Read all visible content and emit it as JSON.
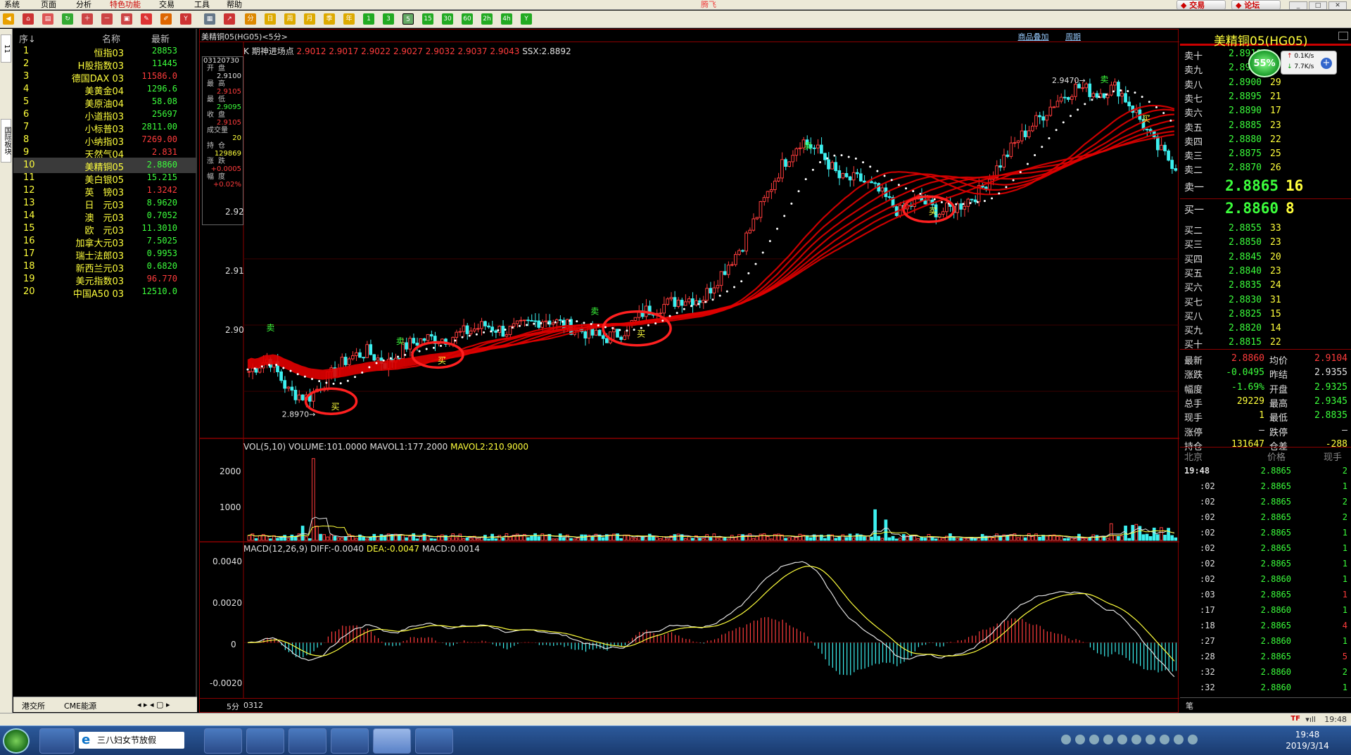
{
  "menu": {
    "items": [
      "系统",
      "页面",
      "分析",
      "特色功能",
      "交易",
      "工具",
      "帮助"
    ],
    "brand": "腾飞",
    "trade": "交易",
    "forum": "论坛"
  },
  "toolbar_periods": [
    "1",
    "3",
    "5",
    "15",
    "30",
    "60",
    "2h",
    "4h",
    "Y"
  ],
  "left_tabs": [
    "11",
    "国际板块"
  ],
  "watch": {
    "headers": {
      "seq": "序↓",
      "name": "名称",
      "last": "最新"
    },
    "rows": [
      {
        "n": "1",
        "name": "恒指03",
        "price": "28853",
        "color": "#3cff3c"
      },
      {
        "n": "2",
        "name": "H股指数03",
        "price": "11445",
        "color": "#3cff3c"
      },
      {
        "n": "3",
        "name": "德国DAX 03",
        "price": "11586.0",
        "color": "#ff3c3c"
      },
      {
        "n": "4",
        "name": "美黄金04",
        "price": "1296.6",
        "color": "#3cff3c"
      },
      {
        "n": "5",
        "name": "美原油04",
        "price": "58.08",
        "color": "#3cff3c"
      },
      {
        "n": "6",
        "name": "小道指03",
        "price": "25697",
        "color": "#3cff3c"
      },
      {
        "n": "7",
        "name": "小标普03",
        "price": "2811.00",
        "color": "#3cff3c"
      },
      {
        "n": "8",
        "name": "小纳指03",
        "price": "7269.00",
        "color": "#ff3c3c"
      },
      {
        "n": "9",
        "name": "天然气04",
        "price": "2.831",
        "color": "#ff3c3c"
      },
      {
        "n": "10",
        "name": "美精铜05",
        "price": "2.8860",
        "color": "#3cff3c"
      },
      {
        "n": "11",
        "name": "美白银05",
        "price": "15.215",
        "color": "#3cff3c"
      },
      {
        "n": "12",
        "name": "英　镑03",
        "price": "1.3242",
        "color": "#ff3c3c"
      },
      {
        "n": "13",
        "name": "日　元03",
        "price": "8.9620",
        "color": "#3cff3c"
      },
      {
        "n": "14",
        "name": "澳　元03",
        "price": "0.7052",
        "color": "#3cff3c"
      },
      {
        "n": "15",
        "name": "欧　元03",
        "price": "11.3010",
        "color": "#3cff3c"
      },
      {
        "n": "16",
        "name": "加拿大元03",
        "price": "7.5025",
        "color": "#3cff3c"
      },
      {
        "n": "17",
        "name": "瑞士法郎03",
        "price": "0.9953",
        "color": "#3cff3c"
      },
      {
        "n": "18",
        "name": "新西兰元03",
        "price": "0.6820",
        "color": "#3cff3c"
      },
      {
        "n": "19",
        "name": "美元指数03",
        "price": "96.770",
        "color": "#ff3c3c"
      },
      {
        "n": "20",
        "name": "中国A50 03",
        "price": "12510.0",
        "color": "#3cff3c"
      }
    ],
    "footer": {
      "tab1": "港交所",
      "tab2": "CME能源"
    }
  },
  "chart": {
    "title": "美精铜05(HG05)<5分>",
    "link1": "商品叠加",
    "link2": "周期",
    "info": {
      "date": "03120730",
      "open_l": "开盘",
      "open_v": "2.9100",
      "high_l": "最高",
      "high_v": "2.9105",
      "low_l": "最低",
      "low_v": "2.9095",
      "close_l": "收盘",
      "close_v": "2.9105",
      "vol_l": "成交量",
      "vol_v": "20",
      "oi_l": "持仓",
      "oi_v": "129869",
      "chg_l": "涨跌",
      "chg_v": "+0.0005",
      "pct_l": "幅度",
      "pct_v": "+0.02%"
    },
    "legend_k": {
      "k": "K",
      "name": "期神进场点",
      "values": "2.9012 2.9017 2.9022 2.9027 2.9032 2.9037 2.9043",
      "ssx": "SSX:2.8892"
    },
    "legend_vol": {
      "label": "VOL(5,10)",
      "volume": "VOLUME:101.0000",
      "m1": "MAVOL1:177.2000",
      "m2": "MAVOL2:210.9000"
    },
    "legend_macd": {
      "label": "MACD(12,26,9)",
      "diff": "DIFF:-0.0040",
      "dea": "DEA:-0.0047",
      "macd": "MACD:0.0014"
    },
    "y_labels_k": [
      "2.92",
      "2.91",
      "2.90"
    ],
    "y_labels_vol": [
      "2000",
      "1000"
    ],
    "y_labels_macd": [
      "0.0040",
      "0.0020",
      "0",
      "-0.0020"
    ],
    "hi_label": "2.9470",
    "lo_label": "2.8970",
    "sell_mark": "卖",
    "buy_mark": "买",
    "x_footer": {
      "period": "5分",
      "date": "0312"
    }
  },
  "chart_data": {
    "type": "candlestick",
    "title": "美精铜05(HG05)<5分>",
    "price_range": [
      2.893,
      2.9525
    ],
    "high_marked": 2.947,
    "low_marked": 2.897,
    "approx_close_path": [
      2.903,
      2.905,
      2.9,
      2.899,
      2.902,
      2.905,
      2.906,
      2.904,
      2.907,
      2.908,
      2.908,
      2.909,
      2.91,
      2.909,
      2.91,
      2.911,
      2.91,
      2.909,
      2.908,
      2.909,
      2.912,
      2.913,
      2.914,
      2.914,
      2.918,
      2.922,
      2.928,
      2.934,
      2.938,
      2.936,
      2.932,
      2.932,
      2.93,
      2.927,
      2.929,
      2.927,
      2.928,
      2.93,
      2.934,
      2.938,
      2.941,
      2.944,
      2.946,
      2.945,
      2.946,
      2.942,
      2.937,
      2.934
    ],
    "volume_range": [
      0,
      2600
    ],
    "volume_peak": 2400,
    "macd_range": [
      -0.0028,
      0.0045
    ],
    "signals": [
      {
        "type": "sell",
        "price": 2.9085
      },
      {
        "type": "buy",
        "price": 2.8985
      },
      {
        "type": "sell",
        "price": 2.9065
      },
      {
        "type": "buy",
        "price": 2.9055
      },
      {
        "type": "sell",
        "price": 2.911
      },
      {
        "type": "buy",
        "price": 2.9095
      },
      {
        "type": "sell",
        "price": 2.936
      },
      {
        "type": "buy",
        "price": 2.928
      },
      {
        "type": "sell",
        "price": 2.946
      },
      {
        "type": "buy",
        "price": 2.942
      }
    ]
  },
  "quote": {
    "title": "美精铜05(HG05)",
    "net_pct": "55%",
    "net_up": "0.1K/s",
    "net_down": "7.7K/s",
    "asks": [
      {
        "l": "卖十",
        "p": "2.8910",
        "q": ""
      },
      {
        "l": "卖九",
        "p": "2.8905",
        "q": ""
      },
      {
        "l": "卖八",
        "p": "2.8900",
        "q": "29"
      },
      {
        "l": "卖七",
        "p": "2.8895",
        "q": "21"
      },
      {
        "l": "卖六",
        "p": "2.8890",
        "q": "17"
      },
      {
        "l": "卖五",
        "p": "2.8885",
        "q": "23"
      },
      {
        "l": "卖四",
        "p": "2.8880",
        "q": "22"
      },
      {
        "l": "卖三",
        "p": "2.8875",
        "q": "25"
      },
      {
        "l": "卖二",
        "p": "2.8870",
        "q": "26"
      }
    ],
    "ask1": {
      "l": "卖一",
      "p": "2.8865",
      "q": "16"
    },
    "bid1": {
      "l": "买一",
      "p": "2.8860",
      "q": "8"
    },
    "bids": [
      {
        "l": "买二",
        "p": "2.8855",
        "q": "33"
      },
      {
        "l": "买三",
        "p": "2.8850",
        "q": "23"
      },
      {
        "l": "买四",
        "p": "2.8845",
        "q": "20"
      },
      {
        "l": "买五",
        "p": "2.8840",
        "q": "23"
      },
      {
        "l": "买六",
        "p": "2.8835",
        "q": "24"
      },
      {
        "l": "买七",
        "p": "2.8830",
        "q": "31"
      },
      {
        "l": "买八",
        "p": "2.8825",
        "q": "15"
      },
      {
        "l": "买九",
        "p": "2.8820",
        "q": "14"
      },
      {
        "l": "买十",
        "p": "2.8815",
        "q": "22"
      }
    ],
    "stats": [
      {
        "a": "最新",
        "av": "2.8860",
        "ac": "#ff3c3c",
        "b": "均价",
        "bv": "2.9104",
        "bc": "#ff3c3c"
      },
      {
        "a": "涨跌",
        "av": "-0.0495",
        "ac": "#3cff3c",
        "b": "昨结",
        "bv": "2.9355",
        "bc": "#e0e0e0"
      },
      {
        "a": "幅度",
        "av": "-1.69%",
        "ac": "#3cff3c",
        "b": "开盘",
        "bv": "2.9325",
        "bc": "#3cff3c"
      },
      {
        "a": "总手",
        "av": "29229",
        "ac": "#ffff3c",
        "b": "最高",
        "bv": "2.9345",
        "bc": "#3cff3c"
      },
      {
        "a": "现手",
        "av": "1",
        "ac": "#ffff3c",
        "b": "最低",
        "bv": "2.8835",
        "bc": "#3cff3c"
      },
      {
        "a": "涨停",
        "av": "—",
        "ac": "#e0e0e0",
        "b": "跌停",
        "bv": "—",
        "bc": "#e0e0e0"
      },
      {
        "a": "持仓",
        "av": "131647",
        "ac": "#ffff3c",
        "b": "仓差",
        "bv": "-288",
        "bc": "#ffff3c"
      }
    ],
    "ticks_header": {
      "loc": "北京",
      "price": "价格",
      "vol": "现手"
    },
    "ticks": [
      {
        "t": "19:48",
        "p": "2.8865",
        "v": "2",
        "c": "#3cff3c"
      },
      {
        "t": ":02",
        "p": "2.8865",
        "v": "1",
        "c": "#3cff3c"
      },
      {
        "t": ":02",
        "p": "2.8865",
        "v": "2",
        "c": "#3cff3c"
      },
      {
        "t": ":02",
        "p": "2.8865",
        "v": "2",
        "c": "#3cff3c"
      },
      {
        "t": ":02",
        "p": "2.8865",
        "v": "1",
        "c": "#3cff3c"
      },
      {
        "t": ":02",
        "p": "2.8865",
        "v": "1",
        "c": "#3cff3c"
      },
      {
        "t": ":02",
        "p": "2.8865",
        "v": "1",
        "c": "#3cff3c"
      },
      {
        "t": ":02",
        "p": "2.8860",
        "v": "1",
        "c": "#3cff3c"
      },
      {
        "t": ":03",
        "p": "2.8865",
        "v": "1",
        "c": "#ff3c3c"
      },
      {
        "t": ":17",
        "p": "2.8860",
        "v": "1",
        "c": "#3cff3c"
      },
      {
        "t": ":18",
        "p": "2.8865",
        "v": "4",
        "c": "#ff3c3c"
      },
      {
        "t": ":27",
        "p": "2.8860",
        "v": "1",
        "c": "#3cff3c"
      },
      {
        "t": ":28",
        "p": "2.8865",
        "v": "5",
        "c": "#ff3c3c"
      },
      {
        "t": ":32",
        "p": "2.8860",
        "v": "2",
        "c": "#3cff3c"
      },
      {
        "t": ":32",
        "p": "2.8860",
        "v": "1",
        "c": "#3cff3c"
      }
    ],
    "foot": "笔"
  },
  "status": {
    "time": "19:48",
    "flag": "TF"
  },
  "taskbar": {
    "search": "三八妇女节放假",
    "clock_time": "19:48",
    "clock_date": "2019/3/14"
  }
}
